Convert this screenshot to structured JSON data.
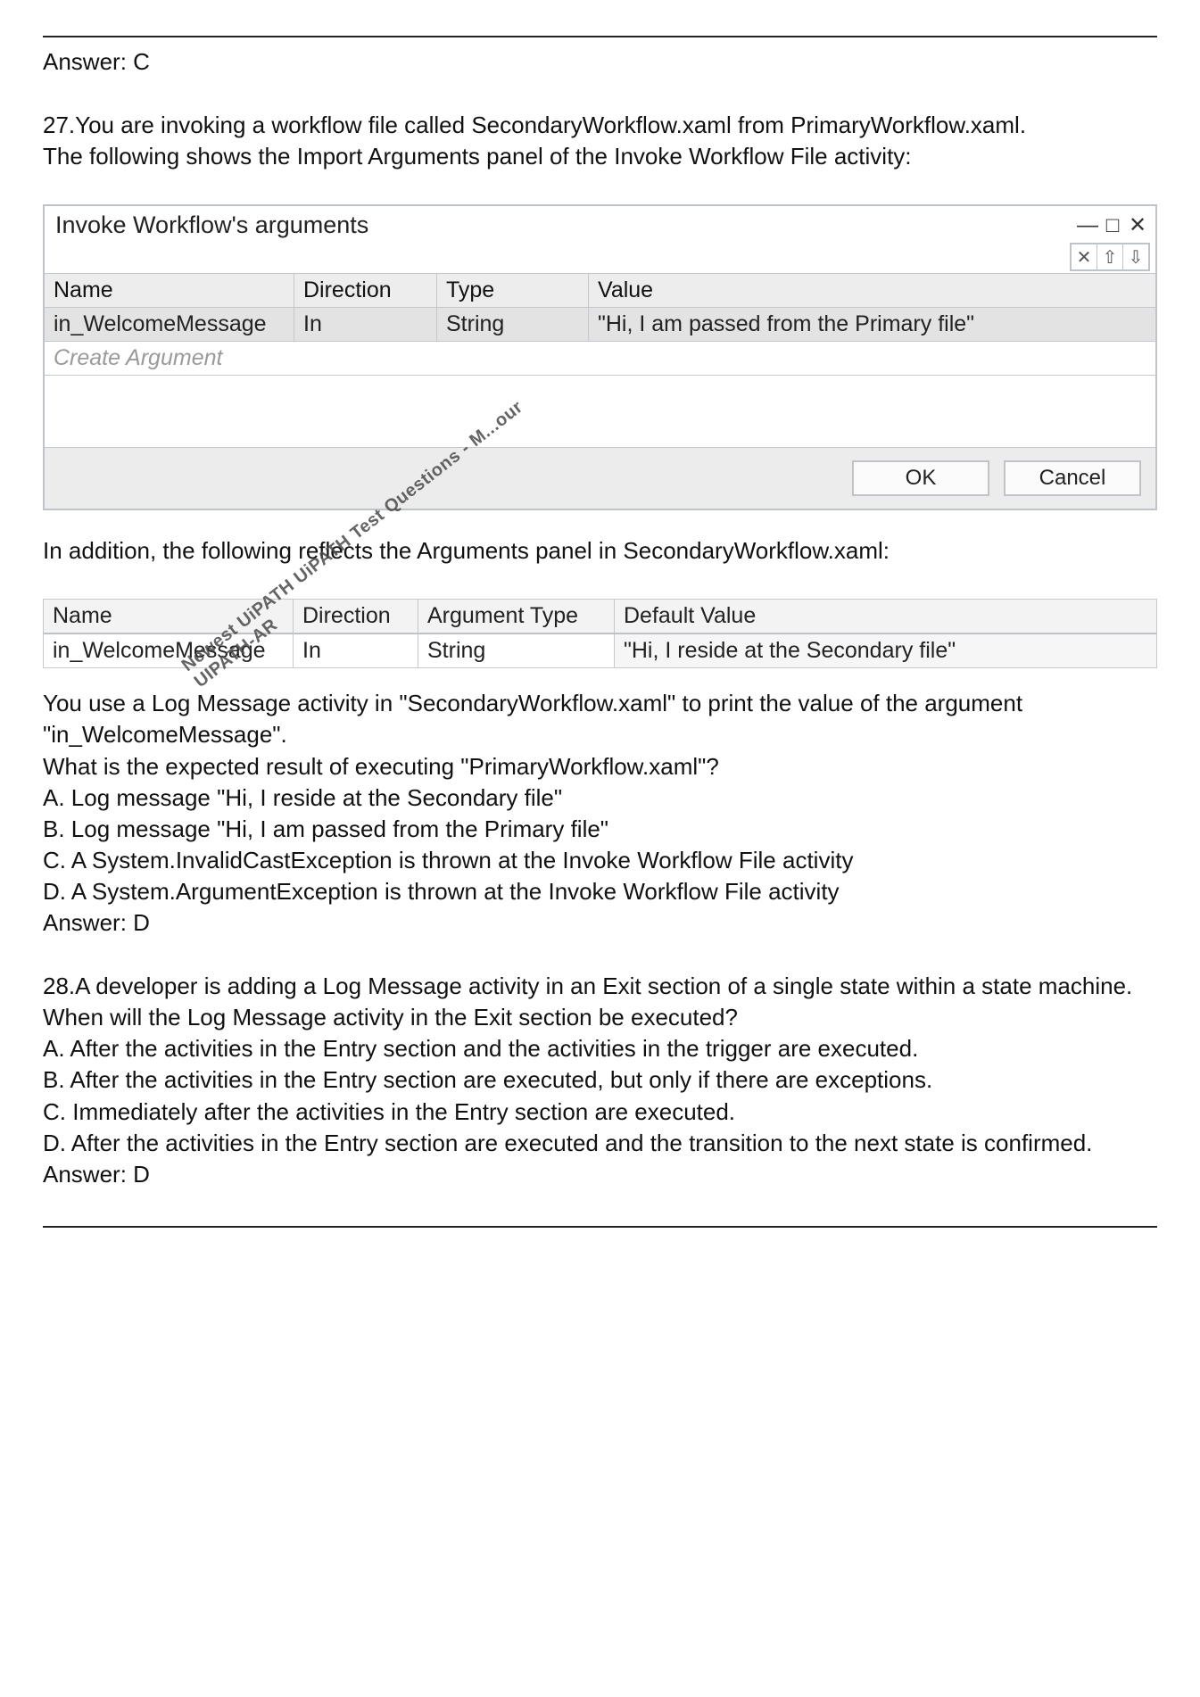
{
  "top_answer": "Answer: C",
  "q27": {
    "intro1": "27.You are invoking a workflow file called SecondaryWorkflow.xaml from PrimaryWorkflow.xaml.",
    "intro2": "The following shows the Import Arguments panel of the Invoke Workflow File activity:",
    "mid1": "In addition, the following reflects the Arguments panel in SecondaryWorkflow.xaml:",
    "after1": "You use a Log Message activity in \"SecondaryWorkflow.xaml\" to print the value of the argument \"in_WelcomeMessage\".",
    "after2": "What is the expected result of executing \"PrimaryWorkflow.xaml\"?",
    "optA": "A. Log message \"Hi, I reside at the Secondary file\"",
    "optB": "B. Log message \"Hi, I am passed from the Primary file\"",
    "optC": "C. A System.InvalidCastException is thrown at the Invoke Workflow File activity",
    "optD": "D. A System.ArgumentException is thrown at the Invoke Workflow File activity",
    "answer": "Answer: D"
  },
  "dialog": {
    "title": "Invoke Workflow's arguments",
    "cols": {
      "name": "Name",
      "direction": "Direction",
      "type": "Type",
      "value": "Value"
    },
    "row": {
      "name": "in_WelcomeMessage",
      "direction": "In",
      "type": "String",
      "value": "\"Hi, I am passed from the Primary file\""
    },
    "create": "Create Argument",
    "ok": "OK",
    "cancel": "Cancel"
  },
  "table2": {
    "cols": {
      "name": "Name",
      "direction": "Direction",
      "type": "Argument Type",
      "value": "Default Value"
    },
    "row": {
      "name": "in_WelcomeMessage",
      "direction": "In",
      "type": "String",
      "value": "\"Hi, I reside at the Secondary file\""
    }
  },
  "q28": {
    "intro1": "28.A developer is adding a Log Message activity in an Exit section of a single state within a state machine.",
    "intro2": "When will the Log Message activity in the Exit section be executed?",
    "optA": "A. After the activities in the Entry section and the activities in the trigger are executed.",
    "optB": "B. After the activities in the Entry section are executed, but only if there are exceptions.",
    "optC": "C. Immediately after the activities in the Entry section are executed.",
    "optD": "D. After the activities in the Entry section are executed and the transition to the next state is confirmed.",
    "answer": "Answer: D"
  },
  "watermark": "Newest UiPATH UiPATH Test Questions - M...our UIPATH-AR"
}
